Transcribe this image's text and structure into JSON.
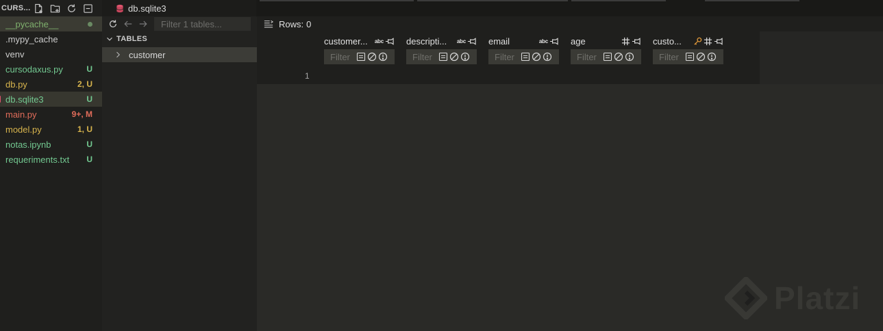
{
  "explorer": {
    "title": "CURS...",
    "files": [
      {
        "name": "__pycache__",
        "status": "",
        "color": "#7fb06d",
        "dot": true,
        "state": "active"
      },
      {
        "name": ".mypy_cache",
        "status": "",
        "color": "#cccccc",
        "dot": false,
        "state": ""
      },
      {
        "name": "venv",
        "status": "",
        "color": "#cccccc",
        "dot": false,
        "state": ""
      },
      {
        "name": "cursodaxus.py",
        "status": "U",
        "color": "#73c991",
        "dot": false,
        "state": ""
      },
      {
        "name": "db.py",
        "status": "2, U",
        "color": "#d7b44d",
        "dot": false,
        "state": ""
      },
      {
        "name": "db.sqlite3",
        "status": "U",
        "color": "#73c991",
        "dot": false,
        "state": "selected"
      },
      {
        "name": "main.py",
        "status": "9+, M",
        "color": "#e06c5a",
        "dot": false,
        "state": ""
      },
      {
        "name": "model.py",
        "status": "1, U",
        "color": "#d7b44d",
        "dot": false,
        "state": ""
      },
      {
        "name": "notas.ipynb",
        "status": "U",
        "color": "#73c991",
        "dot": false,
        "state": ""
      },
      {
        "name": "requeriments.txt",
        "status": "U",
        "color": "#73c991",
        "dot": false,
        "state": ""
      }
    ]
  },
  "tab": {
    "label": "db.sqlite3",
    "icon": "database-icon",
    "icon_color": "#e0556e"
  },
  "tables_panel": {
    "filter_placeholder": "Filter 1 tables...",
    "section_label": "TABLES",
    "items": [
      {
        "label": "customer"
      }
    ]
  },
  "grid": {
    "rows_label": "Rows:",
    "rows_count": "0",
    "row_number": "1",
    "filter_placeholder": "Filter",
    "columns": [
      {
        "title": "customer...",
        "type": "abc",
        "key": false
      },
      {
        "title": "descripti...",
        "type": "abc",
        "key": false
      },
      {
        "title": "email",
        "type": "abc",
        "key": false
      },
      {
        "title": "age",
        "type": "#",
        "key": false
      },
      {
        "title": "custo...",
        "type": "#",
        "key": true
      }
    ]
  },
  "watermark": {
    "text": "Platzi"
  },
  "colors": {
    "accent_key": "#e0983a"
  }
}
